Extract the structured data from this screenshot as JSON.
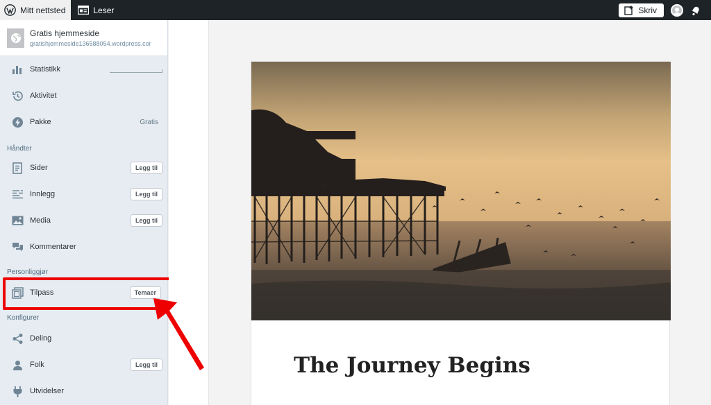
{
  "topbar": {
    "site_label": "Mitt nettsted",
    "reader_label": "Leser",
    "write_label": "Skriv"
  },
  "site": {
    "name": "Gratis hjemmeside",
    "url": "gratishjemmeside136588054.wordpress.cor"
  },
  "sidebar": {
    "items_top": [
      {
        "label": "Statistikk",
        "icon": "bar-chart-icon"
      },
      {
        "label": "Aktivitet",
        "icon": "history-icon"
      },
      {
        "label": "Pakke",
        "icon": "plan-bolt-icon",
        "badge": "Gratis"
      }
    ],
    "section_manage": "Håndter",
    "items_manage": [
      {
        "label": "Sider",
        "icon": "pages-icon",
        "action": "Legg til"
      },
      {
        "label": "Innlegg",
        "icon": "posts-icon",
        "action": "Legg til"
      },
      {
        "label": "Media",
        "icon": "media-icon",
        "action": "Legg til"
      },
      {
        "label": "Kommentarer",
        "icon": "comments-icon"
      }
    ],
    "section_personalize": "Personliggjør",
    "items_personalize": [
      {
        "label": "Tilpass",
        "icon": "customize-icon",
        "action": "Temaer"
      }
    ],
    "section_configure": "Konfigurer",
    "items_configure": [
      {
        "label": "Deling",
        "icon": "share-icon"
      },
      {
        "label": "Folk",
        "icon": "user-icon",
        "action": "Legg til"
      },
      {
        "label": "Utvidelser",
        "icon": "plug-icon"
      }
    ]
  },
  "post": {
    "title": "The Journey Begins"
  },
  "colors": {
    "topbar": "#1d2327",
    "sidebar": "#e6ecf1",
    "highlight": "#ee0000",
    "arrow": "#ee0000"
  }
}
